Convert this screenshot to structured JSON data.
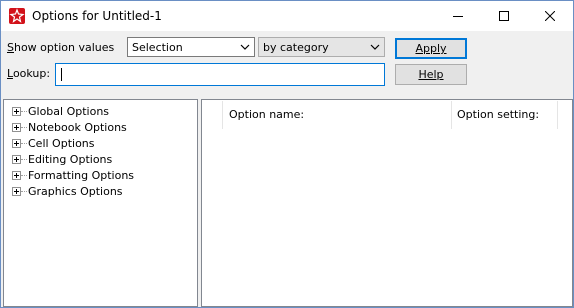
{
  "window": {
    "title": "Options for Untitled-1",
    "icon": "wolfram-spikey-icon",
    "accent_color": "#d2121a"
  },
  "toolbar": {
    "show_label_prefix": "S",
    "show_label_rest": "how option values",
    "scope_select": {
      "value": "Selection"
    },
    "grouping_select": {
      "value": "by category"
    },
    "apply_label": "Apply",
    "lookup_label_prefix": "L",
    "lookup_label_rest": "ookup:",
    "lookup_value": "",
    "help_label": "Help"
  },
  "tree": {
    "items": [
      {
        "label": "Global Options"
      },
      {
        "label": "Notebook Options"
      },
      {
        "label": "Cell Options"
      },
      {
        "label": "Editing Options"
      },
      {
        "label": "Formatting Options"
      },
      {
        "label": "Graphics Options"
      }
    ]
  },
  "list": {
    "columns": [
      "Option name:",
      "Option setting:"
    ]
  }
}
